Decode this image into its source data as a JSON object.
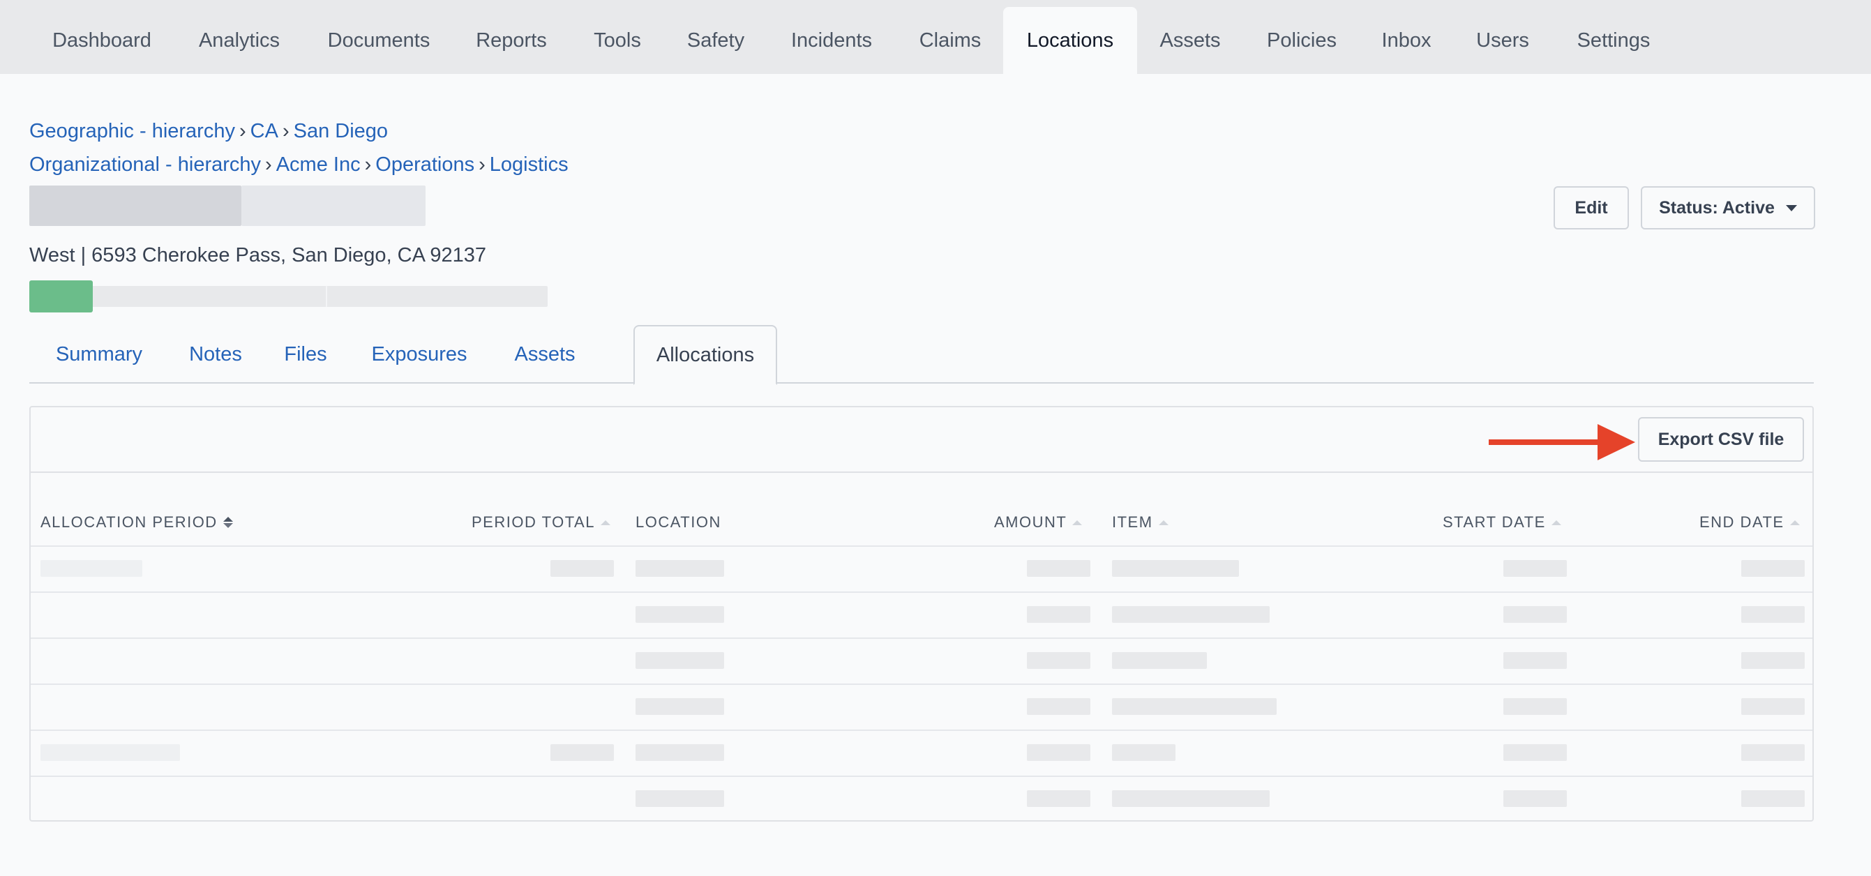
{
  "topnav": {
    "items": [
      {
        "label": "Dashboard"
      },
      {
        "label": "Analytics"
      },
      {
        "label": "Documents"
      },
      {
        "label": "Reports"
      },
      {
        "label": "Tools"
      },
      {
        "label": "Safety"
      },
      {
        "label": "Incidents"
      },
      {
        "label": "Claims"
      },
      {
        "label": "Locations",
        "active": true
      },
      {
        "label": "Assets"
      },
      {
        "label": "Policies"
      },
      {
        "label": "Inbox"
      },
      {
        "label": "Users"
      },
      {
        "label": "Settings"
      }
    ]
  },
  "breadcrumbs": {
    "geo": [
      "Geographic - hierarchy",
      "CA",
      "San Diego"
    ],
    "org": [
      "Organizational - hierarchy",
      "Acme Inc",
      "Operations",
      "Logistics"
    ],
    "separator": "›"
  },
  "location": {
    "address": "West | 6593 Cherokee Pass, San Diego, CA 92137"
  },
  "actions": {
    "edit_label": "Edit",
    "status_label": "Status: Active"
  },
  "tabs": [
    {
      "label": "Summary"
    },
    {
      "label": "Notes"
    },
    {
      "label": "Files"
    },
    {
      "label": "Exposures"
    },
    {
      "label": "Assets"
    },
    {
      "label": "Allocations",
      "active": true
    }
  ],
  "table": {
    "export_label": "Export CSV file",
    "columns": [
      {
        "label": "ALLOCATION PERIOD",
        "sort": "active"
      },
      {
        "label": "PERIOD TOTAL",
        "sort": "inactive"
      },
      {
        "label": "LOCATION",
        "sort": "none"
      },
      {
        "label": "AMOUNT",
        "sort": "inactive"
      },
      {
        "label": "ITEM",
        "sort": "inactive"
      },
      {
        "label": "START DATE",
        "sort": "inactive"
      },
      {
        "label": "END DATE",
        "sort": "inactive"
      }
    ]
  },
  "colors": {
    "accent_link": "#2563b8",
    "progress_fill": "#6bbd8a",
    "annotation_arrow": "#e5432a"
  }
}
